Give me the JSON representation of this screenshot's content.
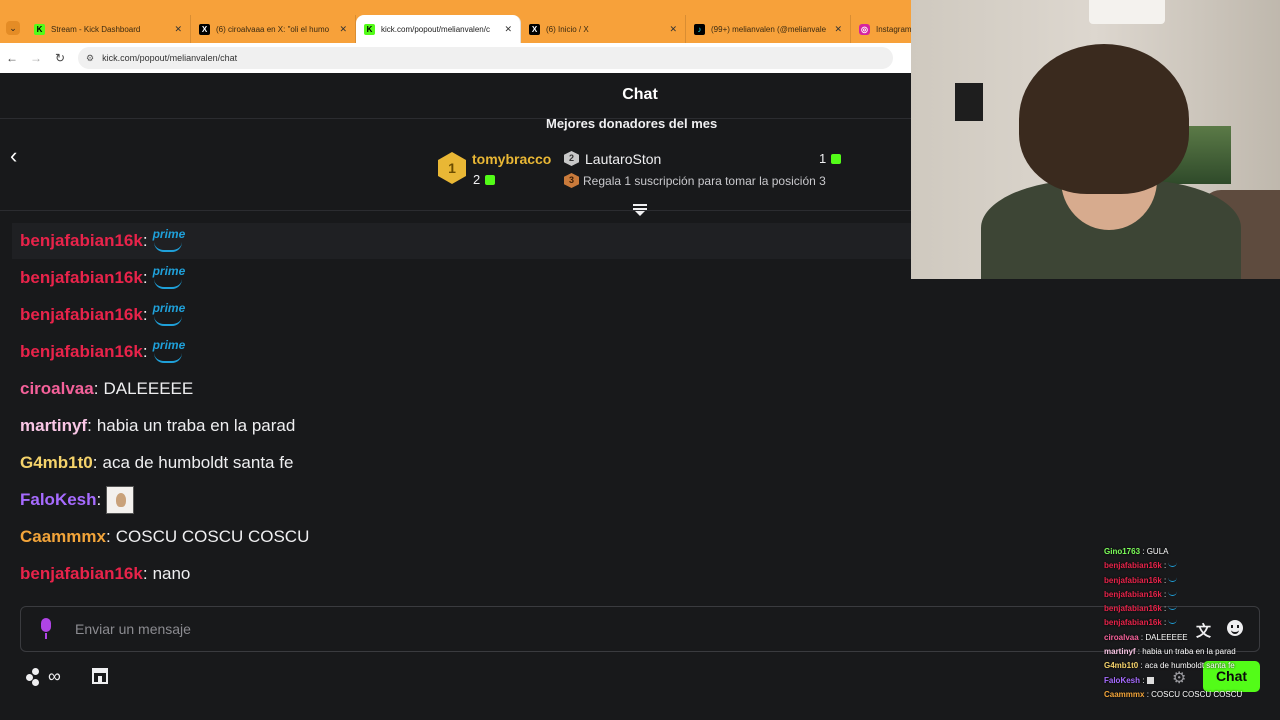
{
  "browser": {
    "tabs": [
      {
        "label": "Stream - Kick Dashboard",
        "icon": "kick-icon",
        "active": false
      },
      {
        "label": "(6) ciroalvaaa en X: \"oli el humo",
        "icon": "x-icon",
        "active": false
      },
      {
        "label": "kick.com/popout/melianvalen/c",
        "icon": "kick-icon",
        "active": true
      },
      {
        "label": "(6) Inicio / X",
        "icon": "x-icon",
        "active": false
      },
      {
        "label": "(99+) melianvalen (@melianvale",
        "icon": "tiktok-icon",
        "active": false
      },
      {
        "label": "Instagram",
        "icon": "instagram-icon",
        "active": false
      }
    ],
    "url": "kick.com/popout/melianvalen/chat"
  },
  "chat": {
    "title": "Chat",
    "donors_title": "Mejores donadores del mes",
    "donors": [
      {
        "rank": "1",
        "name": "tomybracco",
        "count": "2"
      },
      {
        "rank": "2",
        "name": "LautaroSton",
        "count": "1"
      },
      {
        "rank": "3",
        "text": "Regala 1 suscripción para tomar la posición 3"
      }
    ],
    "messages": [
      {
        "user": "benjafabian16k",
        "color": "#e8234a",
        "emote": "prime"
      },
      {
        "user": "benjafabian16k",
        "color": "#e8234a",
        "emote": "prime"
      },
      {
        "user": "benjafabian16k",
        "color": "#e8234a",
        "emote": "prime"
      },
      {
        "user": "benjafabian16k",
        "color": "#e8234a",
        "emote": "prime"
      },
      {
        "user": "ciroalvaa",
        "color": "#f4619a",
        "text": "DALEEEEE"
      },
      {
        "user": "martinyf",
        "color": "#f9c6e5",
        "text": "habia un traba en la parad"
      },
      {
        "user": "G4mb1t0",
        "color": "#f5d36b",
        "text": "aca de humboldt santa fe"
      },
      {
        "user": "FaloKesh",
        "color": "#a66bff",
        "emote": "image"
      },
      {
        "user": "Caammmx",
        "color": "#f2a43a",
        "text": "COSCU COSCU COSCU"
      },
      {
        "user": "benjafabian16k",
        "color": "#e8234a",
        "text": "nano"
      }
    ],
    "prime_text": "prime",
    "input_placeholder": "Enviar un mensaje",
    "points_symbol": "∞",
    "chat_button": "Chat"
  },
  "overlay": {
    "lines": [
      {
        "user": "Gino1763",
        "color": "#7dff5a",
        "text": "GULA"
      },
      {
        "user": "benjafabian16k",
        "color": "#e8234a",
        "emote": "prime"
      },
      {
        "user": "benjafabian16k",
        "color": "#e8234a",
        "emote": "prime"
      },
      {
        "user": "benjafabian16k",
        "color": "#e8234a",
        "emote": "prime"
      },
      {
        "user": "benjafabian16k",
        "color": "#e8234a",
        "emote": "prime"
      },
      {
        "user": "benjafabian16k",
        "color": "#e8234a",
        "emote": "prime"
      },
      {
        "user": "ciroalvaa",
        "color": "#f4619a",
        "text": "DALEEEEE"
      },
      {
        "user": "martinyf",
        "color": "#f9c6e5",
        "text": "habia un traba en la parad"
      },
      {
        "user": "G4mb1t0",
        "color": "#f5d36b",
        "text": "aca de humboldt santa fe"
      },
      {
        "user": "FaloKesh",
        "color": "#a66bff",
        "emote": "image"
      },
      {
        "user": "Caammmx",
        "color": "#f2a43a",
        "text": "COSCU COSCU COSCU"
      }
    ]
  },
  "colors": {
    "kick_green": "#53fc18",
    "background": "#18191b",
    "gold": "#e9b735",
    "tab_bar": "#f7a13a"
  }
}
